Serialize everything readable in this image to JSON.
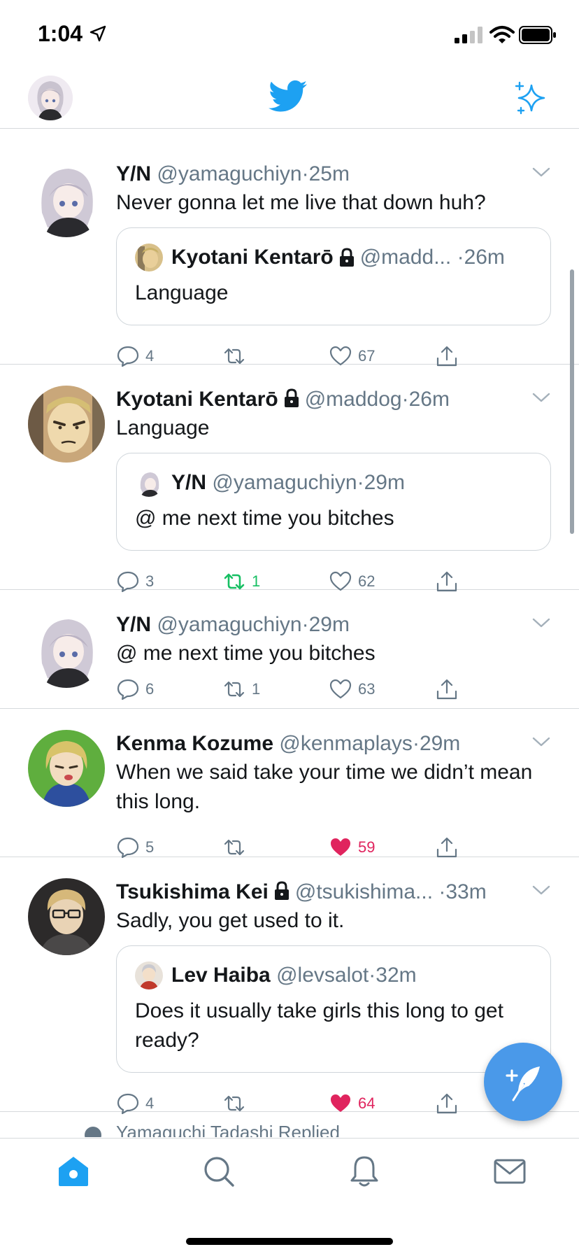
{
  "status_bar": {
    "time": "1:04"
  },
  "colors": {
    "accent": "#1da1f2",
    "retweet": "#17bf63",
    "like": "#e0245e",
    "muted": "#657786"
  },
  "tweets": [
    {
      "name": "Y/N",
      "handle": "@yamaguchiyn",
      "time": "25m",
      "locked": false,
      "text": "Never gonna let me live that down huh?",
      "quote": {
        "name": "Kyotani Kentarō",
        "handle": "@madd...",
        "time": "26m",
        "locked": true,
        "text": "Language"
      },
      "replies": "4",
      "retweets": "",
      "likes": "67",
      "liked": false,
      "retweeted": false
    },
    {
      "name": "Kyotani Kentarō",
      "handle": "@maddog",
      "time": "26m",
      "locked": true,
      "text": "Language",
      "quote": {
        "name": "Y/N",
        "handle": "@yamaguchiyn",
        "time": "29m",
        "locked": false,
        "text": "@ me next time you bitches"
      },
      "replies": "3",
      "retweets": "1",
      "likes": "62",
      "liked": false,
      "retweeted": true
    },
    {
      "name": "Y/N",
      "handle": "@yamaguchiyn",
      "time": "29m",
      "locked": false,
      "text": "@ me next time you bitches",
      "replies": "6",
      "retweets": "1",
      "likes": "63",
      "liked": false,
      "retweeted": false
    },
    {
      "name": "Kenma Kozume",
      "handle": "@kenmaplays",
      "time": "29m",
      "locked": false,
      "text": "When we said take your time we didn’t mean this long.",
      "replies": "5",
      "retweets": "",
      "likes": "59",
      "liked": true,
      "retweeted": false
    },
    {
      "name": "Tsukishima Kei",
      "handle": "@tsukishima...",
      "time": "33m",
      "locked": true,
      "text": "Sadly, you get used to it.",
      "quote": {
        "name": "Lev Haiba",
        "handle": "@levsalot",
        "time": "32m",
        "locked": false,
        "text": "Does it usually take girls this long to get ready?"
      },
      "replies": "4",
      "retweets": "",
      "likes": "64",
      "liked": true,
      "retweeted": false
    }
  ],
  "reply_hint": "Yamaguchi Tadashi Replied"
}
